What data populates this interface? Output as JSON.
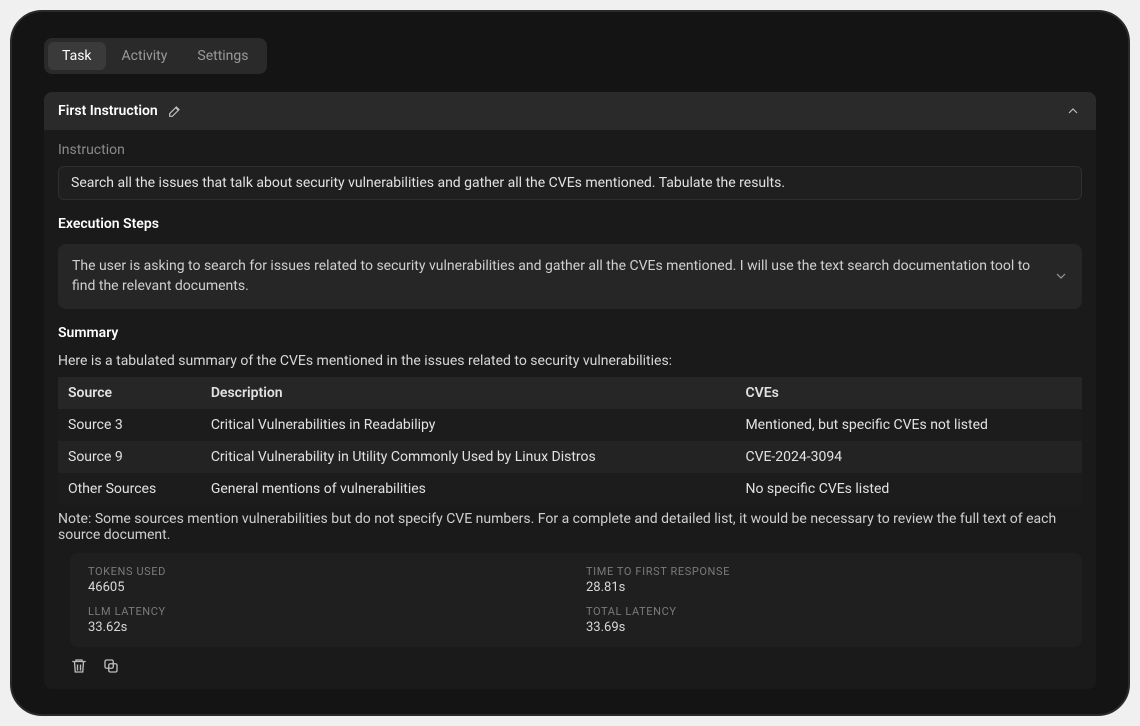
{
  "tabs": {
    "task": "Task",
    "activity": "Activity",
    "settings": "Settings"
  },
  "instruction": {
    "section_title": "First Instruction",
    "label": "Instruction",
    "text": "Search all the issues that talk about security vulnerabilities and gather all the CVEs mentioned. Tabulate the results."
  },
  "execution": {
    "heading": "Execution Steps",
    "step_text": "The user is asking to search for issues related to security vulnerabilities and gather all the CVEs mentioned. I will use the text search documentation tool to find the relevant documents."
  },
  "summary": {
    "heading": "Summary",
    "intro": "Here is a tabulated summary of the CVEs mentioned in the issues related to security vulnerabilities:",
    "columns": {
      "source": "Source",
      "description": "Description",
      "cves": "CVEs"
    },
    "rows": [
      {
        "source": "Source 3",
        "description": "Critical Vulnerabilities in Readabilipy",
        "cves": "Mentioned, but specific CVEs not listed"
      },
      {
        "source": "Source 9",
        "description": "Critical Vulnerability in Utility Commonly Used by Linux Distros",
        "cves": "CVE-2024-3094"
      },
      {
        "source": "Other Sources",
        "description": "General mentions of vulnerabilities",
        "cves": "No specific CVEs listed"
      }
    ],
    "note": "Note: Some sources mention vulnerabilities but do not specify CVE numbers. For a complete and detailed list, it would be necessary to review the full text of each source document."
  },
  "metrics": {
    "tokens_used": {
      "label": "TOKENS USED",
      "value": "46605"
    },
    "ttfr": {
      "label": "TIME TO FIRST RESPONSE",
      "value": "28.81s"
    },
    "llm_latency": {
      "label": "LLM LATENCY",
      "value": "33.62s"
    },
    "total_latency": {
      "label": "TOTAL LATENCY",
      "value": "33.69s"
    }
  }
}
